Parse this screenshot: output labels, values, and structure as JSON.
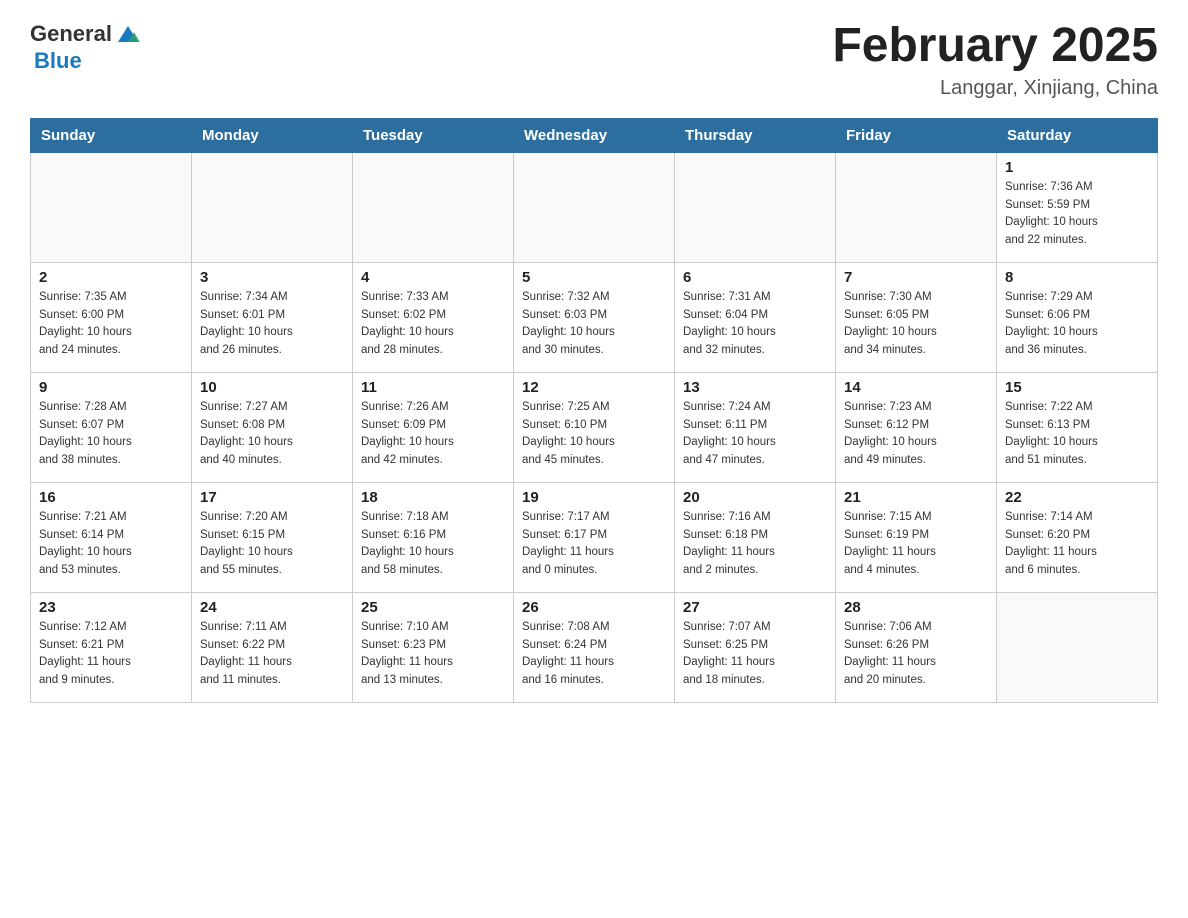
{
  "header": {
    "logo_general": "General",
    "logo_blue": "Blue",
    "title": "February 2025",
    "subtitle": "Langgar, Xinjiang, China"
  },
  "days_of_week": [
    "Sunday",
    "Monday",
    "Tuesday",
    "Wednesday",
    "Thursday",
    "Friday",
    "Saturday"
  ],
  "weeks": [
    [
      {
        "day": "",
        "info": ""
      },
      {
        "day": "",
        "info": ""
      },
      {
        "day": "",
        "info": ""
      },
      {
        "day": "",
        "info": ""
      },
      {
        "day": "",
        "info": ""
      },
      {
        "day": "",
        "info": ""
      },
      {
        "day": "1",
        "info": "Sunrise: 7:36 AM\nSunset: 5:59 PM\nDaylight: 10 hours\nand 22 minutes."
      }
    ],
    [
      {
        "day": "2",
        "info": "Sunrise: 7:35 AM\nSunset: 6:00 PM\nDaylight: 10 hours\nand 24 minutes."
      },
      {
        "day": "3",
        "info": "Sunrise: 7:34 AM\nSunset: 6:01 PM\nDaylight: 10 hours\nand 26 minutes."
      },
      {
        "day": "4",
        "info": "Sunrise: 7:33 AM\nSunset: 6:02 PM\nDaylight: 10 hours\nand 28 minutes."
      },
      {
        "day": "5",
        "info": "Sunrise: 7:32 AM\nSunset: 6:03 PM\nDaylight: 10 hours\nand 30 minutes."
      },
      {
        "day": "6",
        "info": "Sunrise: 7:31 AM\nSunset: 6:04 PM\nDaylight: 10 hours\nand 32 minutes."
      },
      {
        "day": "7",
        "info": "Sunrise: 7:30 AM\nSunset: 6:05 PM\nDaylight: 10 hours\nand 34 minutes."
      },
      {
        "day": "8",
        "info": "Sunrise: 7:29 AM\nSunset: 6:06 PM\nDaylight: 10 hours\nand 36 minutes."
      }
    ],
    [
      {
        "day": "9",
        "info": "Sunrise: 7:28 AM\nSunset: 6:07 PM\nDaylight: 10 hours\nand 38 minutes."
      },
      {
        "day": "10",
        "info": "Sunrise: 7:27 AM\nSunset: 6:08 PM\nDaylight: 10 hours\nand 40 minutes."
      },
      {
        "day": "11",
        "info": "Sunrise: 7:26 AM\nSunset: 6:09 PM\nDaylight: 10 hours\nand 42 minutes."
      },
      {
        "day": "12",
        "info": "Sunrise: 7:25 AM\nSunset: 6:10 PM\nDaylight: 10 hours\nand 45 minutes."
      },
      {
        "day": "13",
        "info": "Sunrise: 7:24 AM\nSunset: 6:11 PM\nDaylight: 10 hours\nand 47 minutes."
      },
      {
        "day": "14",
        "info": "Sunrise: 7:23 AM\nSunset: 6:12 PM\nDaylight: 10 hours\nand 49 minutes."
      },
      {
        "day": "15",
        "info": "Sunrise: 7:22 AM\nSunset: 6:13 PM\nDaylight: 10 hours\nand 51 minutes."
      }
    ],
    [
      {
        "day": "16",
        "info": "Sunrise: 7:21 AM\nSunset: 6:14 PM\nDaylight: 10 hours\nand 53 minutes."
      },
      {
        "day": "17",
        "info": "Sunrise: 7:20 AM\nSunset: 6:15 PM\nDaylight: 10 hours\nand 55 minutes."
      },
      {
        "day": "18",
        "info": "Sunrise: 7:18 AM\nSunset: 6:16 PM\nDaylight: 10 hours\nand 58 minutes."
      },
      {
        "day": "19",
        "info": "Sunrise: 7:17 AM\nSunset: 6:17 PM\nDaylight: 11 hours\nand 0 minutes."
      },
      {
        "day": "20",
        "info": "Sunrise: 7:16 AM\nSunset: 6:18 PM\nDaylight: 11 hours\nand 2 minutes."
      },
      {
        "day": "21",
        "info": "Sunrise: 7:15 AM\nSunset: 6:19 PM\nDaylight: 11 hours\nand 4 minutes."
      },
      {
        "day": "22",
        "info": "Sunrise: 7:14 AM\nSunset: 6:20 PM\nDaylight: 11 hours\nand 6 minutes."
      }
    ],
    [
      {
        "day": "23",
        "info": "Sunrise: 7:12 AM\nSunset: 6:21 PM\nDaylight: 11 hours\nand 9 minutes."
      },
      {
        "day": "24",
        "info": "Sunrise: 7:11 AM\nSunset: 6:22 PM\nDaylight: 11 hours\nand 11 minutes."
      },
      {
        "day": "25",
        "info": "Sunrise: 7:10 AM\nSunset: 6:23 PM\nDaylight: 11 hours\nand 13 minutes."
      },
      {
        "day": "26",
        "info": "Sunrise: 7:08 AM\nSunset: 6:24 PM\nDaylight: 11 hours\nand 16 minutes."
      },
      {
        "day": "27",
        "info": "Sunrise: 7:07 AM\nSunset: 6:25 PM\nDaylight: 11 hours\nand 18 minutes."
      },
      {
        "day": "28",
        "info": "Sunrise: 7:06 AM\nSunset: 6:26 PM\nDaylight: 11 hours\nand 20 minutes."
      },
      {
        "day": "",
        "info": ""
      }
    ]
  ]
}
